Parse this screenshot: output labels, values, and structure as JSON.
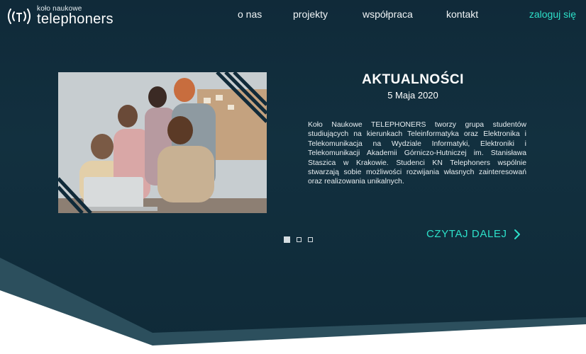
{
  "brand": {
    "small": "koło naukowe",
    "big": "telephoners"
  },
  "nav": {
    "items": [
      "o nas",
      "projekty",
      "współpraca",
      "kontakt"
    ],
    "login": "zaloguj się"
  },
  "news": {
    "title": "AKTUALNOŚCI",
    "date": "5 Maja 2020",
    "body": "Koło Naukowe TELEPHONERS tworzy grupa studentów studiujących na kierunkach Teleinformatyka oraz Elektronika i Telekomunikacja na Wydziale Informatyki, Elektroniki i Telekomunikacji Akademii Górniczo-Hutniczej im. Stanisława Staszica w Krakowie. Studenci KN Telephoners wspólnie stwarzają sobie możliwości rozwijania własnych zainteresowań oraz realizowania unikalnych.",
    "read_more": "CZYTAJ DALEJ"
  },
  "carousel": {
    "slides": 3,
    "active_index": 0
  },
  "colors": {
    "accent": "#2de0c9",
    "background": "#102a39"
  }
}
